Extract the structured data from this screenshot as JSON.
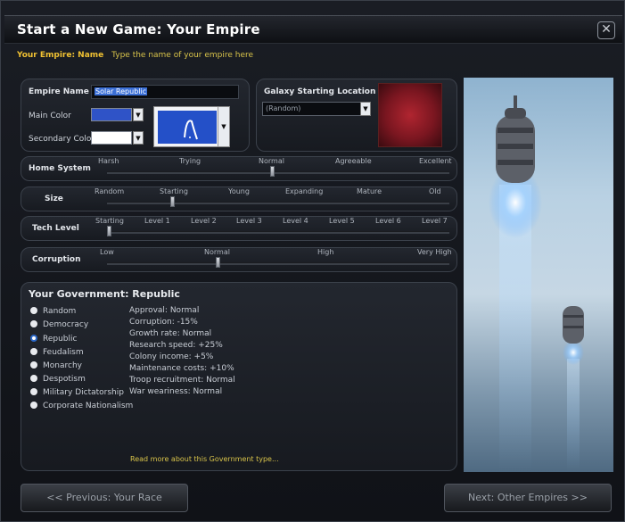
{
  "window": {
    "title": "Start a New Game: Your Empire"
  },
  "hint": {
    "label": "Your Empire: Name",
    "text": "Type the name of your empire here"
  },
  "empire": {
    "name_label": "Empire Name",
    "name_value": "Solar Republic",
    "main_color_label": "Main Color",
    "main_color": "#2f53c7",
    "secondary_color_label": "Secondary Color",
    "secondary_color": "#ffffff"
  },
  "galaxy": {
    "label": "Galaxy Starting Location",
    "selected": "(Random)"
  },
  "sliders": [
    {
      "title": "Home System",
      "ticks": [
        "Harsh",
        "Trying",
        "Normal",
        "Agreeable",
        "Excellent"
      ],
      "value_index": 2
    },
    {
      "title": "Size",
      "ticks": [
        "Random",
        "Starting",
        "Young",
        "Expanding",
        "Mature",
        "Old"
      ],
      "value_index": 1
    },
    {
      "title": "Tech Level",
      "ticks": [
        "Starting",
        "Level 1",
        "Level 2",
        "Level 3",
        "Level 4",
        "Level 5",
        "Level 6",
        "Level 7"
      ],
      "value_index": 0
    },
    {
      "title": "Corruption",
      "ticks": [
        "Low",
        "Normal",
        "High",
        "Very High"
      ],
      "value_index": 1
    }
  ],
  "government": {
    "title": "Your Government: Republic",
    "options": [
      "Random",
      "Democracy",
      "Republic",
      "Feudalism",
      "Monarchy",
      "Despotism",
      "Military Dictatorship",
      "Corporate Nationalism"
    ],
    "selected": "Republic",
    "stats": [
      "Approval: Normal",
      "Corruption: -15%",
      "Growth rate: Normal",
      "Research speed: +25%",
      "Colony income: +5%",
      "Maintenance costs: +10%",
      "Troop recruitment: Normal",
      "War weariness: Normal"
    ],
    "read_more": "Read more about this Government type..."
  },
  "buttons": {
    "prev": "<< Previous: Your Race",
    "next": "Next: Other Empires >>"
  }
}
